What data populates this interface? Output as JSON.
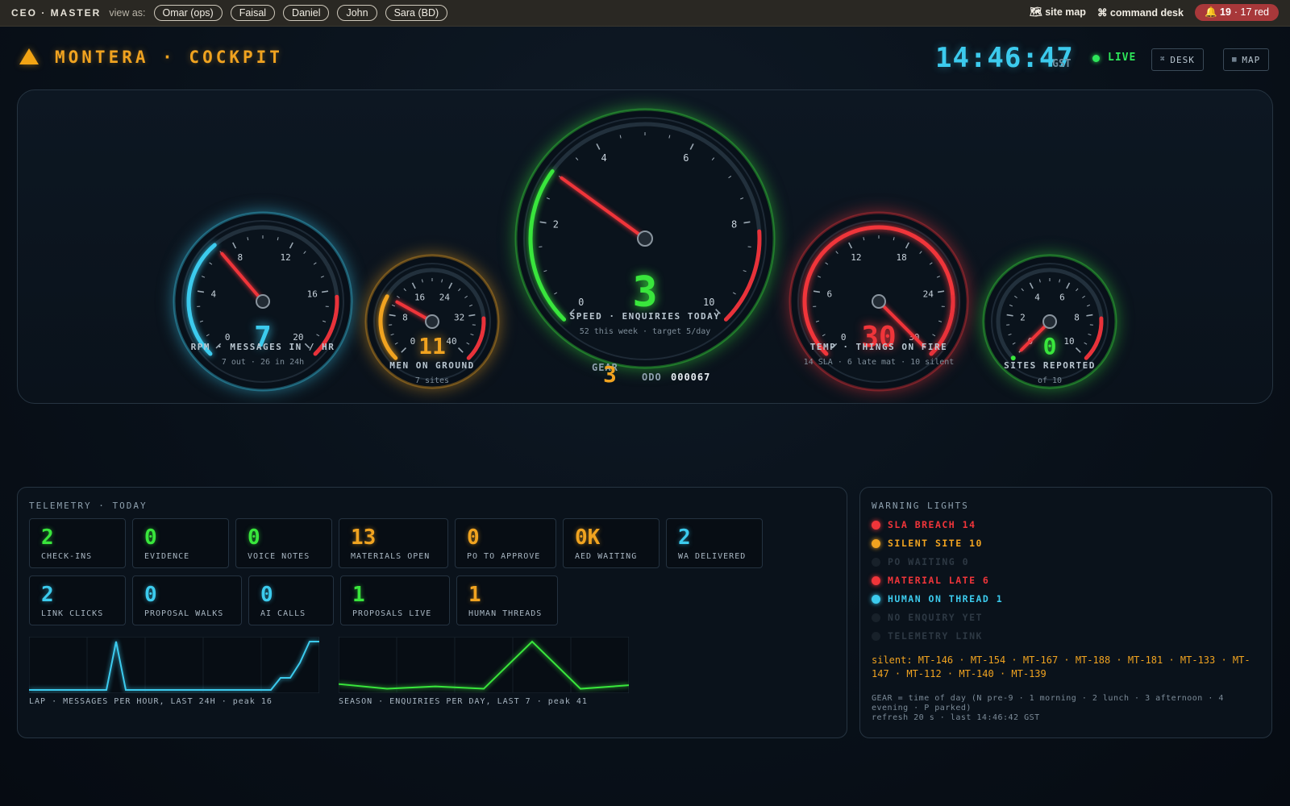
{
  "topbar": {
    "brand": "CEO · MASTER",
    "view_as_label": "view as:",
    "users": [
      "Omar (ops)",
      "Faisal",
      "Daniel",
      "John",
      "Sara (BD)"
    ],
    "site_map": "🗺 site map",
    "command_desk": "⌘ command desk",
    "alert_count": "19",
    "alert_red": "· 17 red"
  },
  "header": {
    "title": "MONTERA · COCKPIT",
    "clock": "14:46:47",
    "timezone": "GST",
    "live": "LIVE",
    "desk_btn": "DESK",
    "map_btn": "MAP"
  },
  "gauges": [
    {
      "id": "rpm",
      "value": "7",
      "label": "RPM · MESSAGES IN / HR",
      "sub": "7 out · 26 in 24h",
      "color": "#3ccbee",
      "min": 0,
      "max": 20,
      "ticks": [
        0,
        4,
        8,
        12,
        16,
        20
      ],
      "needle": 7
    },
    {
      "id": "men",
      "value": "11",
      "label": "MEN ON GROUND",
      "sub": "7 sites",
      "color": "#f0a320",
      "min": 0,
      "max": 40,
      "ticks": [
        0,
        8,
        16,
        24,
        32,
        40
      ],
      "needle": 11
    },
    {
      "id": "speed",
      "value": "3",
      "label": "SPEED · ENQUIRIES TODAY",
      "sub": "52 this week · target 5/day",
      "color": "#39e63c",
      "min": 0,
      "max": 10,
      "ticks": [
        0,
        2,
        4,
        6,
        8,
        10
      ],
      "needle": 3
    },
    {
      "id": "temp",
      "value": "30",
      "label": "TEMP · THINGS ON FIRE",
      "sub": "14 SLA · 6 late mat · 10 silent",
      "color": "#f0353a",
      "min": 0,
      "max": 30,
      "ticks": [
        0,
        6,
        12,
        18,
        24,
        30
      ],
      "needle": 30
    },
    {
      "id": "sites",
      "value": "0",
      "label": "SITES REPORTED",
      "sub": "of 10",
      "color": "#39e63c",
      "min": 0,
      "max": 10,
      "ticks": [
        0,
        2,
        4,
        6,
        8,
        10
      ],
      "needle": 0
    }
  ],
  "gear": {
    "label": "GEAR",
    "value": "3",
    "odo_label": "ODO",
    "odo": "000067"
  },
  "telemetry": {
    "title": "TELEMETRY · TODAY",
    "tiles": [
      {
        "value": "2",
        "label": "CHECK-INS",
        "color": "#39e63c"
      },
      {
        "value": "0",
        "label": "EVIDENCE",
        "color": "#39e63c"
      },
      {
        "value": "0",
        "label": "VOICE NOTES",
        "color": "#39e63c"
      },
      {
        "value": "13",
        "label": "MATERIALS OPEN",
        "color": "#f0a320"
      },
      {
        "value": "0",
        "label": "PO TO APPROVE",
        "color": "#f0a320"
      },
      {
        "value": "0K",
        "label": "AED WAITING",
        "color": "#f0a320"
      },
      {
        "value": "2",
        "label": "WA DELIVERED",
        "color": "#3ccbee"
      },
      {
        "value": "2",
        "label": "LINK CLICKS",
        "color": "#3ccbee"
      },
      {
        "value": "0",
        "label": "PROPOSAL WALKS",
        "color": "#3ccbee"
      },
      {
        "value": "0",
        "label": "AI CALLS",
        "color": "#3ccbee"
      },
      {
        "value": "1",
        "label": "PROPOSALS LIVE",
        "color": "#39e63c"
      },
      {
        "value": "1",
        "label": "HUMAN THREADS",
        "color": "#f0a320"
      }
    ],
    "lap_caption": "LAP · MESSAGES PER HOUR, LAST 24H · peak 16",
    "season_caption": "SEASON · ENQUIRIES PER DAY, LAST 7 · peak 41"
  },
  "chart_data": [
    {
      "type": "line",
      "name": "lap",
      "series": [
        {
          "values": [
            0,
            0,
            0,
            0,
            0,
            0,
            0,
            0,
            0,
            0,
            0,
            0,
            0,
            0,
            0,
            0,
            0,
            0,
            0,
            0,
            0,
            0,
            0,
            0,
            0,
            0,
            0,
            0,
            0,
            0,
            0,
            0,
            0,
            0,
            0,
            0,
            0,
            0,
            0,
            0,
            0,
            0,
            0,
            0,
            0,
            0,
            0,
            0,
            0,
            0,
            0,
            0,
            0,
            0,
            0,
            0,
            0,
            0,
            0,
            0,
            0,
            0,
            0,
            0,
            0,
            0,
            0,
            0,
            0,
            0,
            0,
            0,
            0,
            0,
            0,
            0,
            0,
            0,
            0,
            0,
            0,
            0,
            0,
            0,
            0,
            0,
            0,
            0,
            0,
            0
          ]
        }
      ]
    },
    {
      "type": "line",
      "name": "season",
      "series": [
        {
          "values": [
            5,
            1,
            3,
            1,
            41,
            1,
            4
          ]
        }
      ]
    }
  ],
  "lap_series": [
    0,
    0,
    0,
    0,
    0,
    0,
    0,
    0,
    0,
    16,
    0,
    0,
    0,
    0,
    0,
    0,
    0,
    0,
    0,
    0,
    0,
    0,
    0,
    0,
    0,
    0,
    4,
    4,
    9,
    16,
    16
  ],
  "warnings": {
    "title": "WARNING LIGHTS",
    "items": [
      {
        "label": "SLA BREACH 14",
        "color": "#f0353a",
        "on": true
      },
      {
        "label": "SILENT SITE 10",
        "color": "#f0a320",
        "on": true
      },
      {
        "label": "PO WAITING 0",
        "color": "#2a3440",
        "on": false
      },
      {
        "label": "MATERIAL LATE 6",
        "color": "#f0353a",
        "on": true
      },
      {
        "label": "HUMAN ON THREAD 1",
        "color": "#3ccbee",
        "on": true
      },
      {
        "label": "NO ENQUIRY YET",
        "color": "#2a3440",
        "on": false
      },
      {
        "label": "TELEMETRY LINK",
        "color": "#2a3440",
        "on": false
      }
    ],
    "silent": "silent: MT-146 · MT-154 · MT-167 · MT-188 · MT-181 · MT-133 · MT-147 · MT-112 · MT-140 · MT-139",
    "gear_legend": "GEAR = time of day (N pre-9 · 1 morning · 2 lunch · 3 afternoon · 4 evening · P parked)",
    "refresh": "refresh 20 s · last 14:46:42 GST"
  }
}
